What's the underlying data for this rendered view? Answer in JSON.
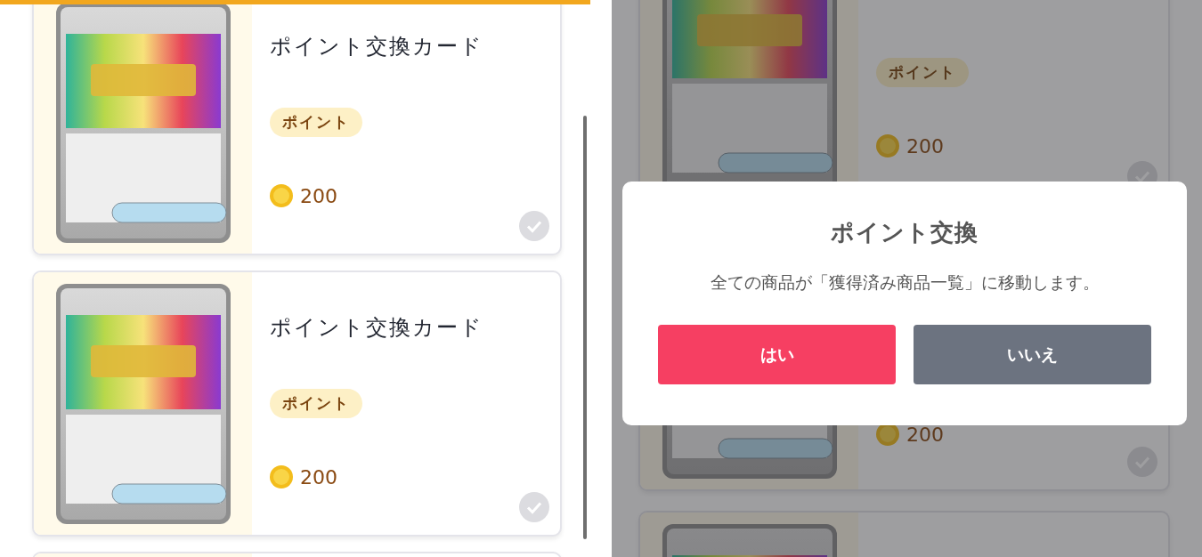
{
  "left_screen": {
    "cards": [
      {
        "kind": "product",
        "title": "ポイント交換カード",
        "tag": "ポイント",
        "price": "200",
        "checked": false
      },
      {
        "kind": "product",
        "title": "ポイント交換カード",
        "tag": "ポイント",
        "price": "200",
        "checked": false
      },
      {
        "kind": "edge"
      }
    ]
  },
  "right_screen": {
    "cards": [
      {
        "kind": "product",
        "tag": "ポイント",
        "price": "200",
        "checked": false
      },
      {
        "kind": "product",
        "price": "200",
        "checked": false
      },
      {
        "kind": "product"
      }
    ],
    "dialog": {
      "title": "ポイント交換",
      "message": "全ての商品が「獲得済み商品一覧」に移動します。",
      "buttons": [
        {
          "label": "はい",
          "kind": "primary"
        },
        {
          "label": "いいえ",
          "kind": "secondary"
        }
      ]
    }
  }
}
